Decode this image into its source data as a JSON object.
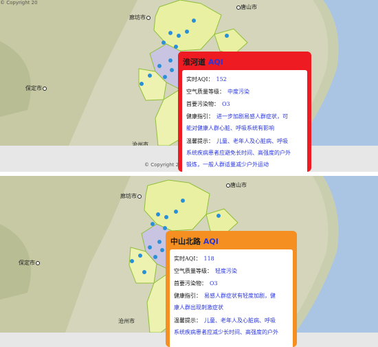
{
  "panels": [
    {
      "cities": {
        "langfang": "廊坊市",
        "tangshan": "唐山市",
        "baoding": "保定市",
        "cangzhou": "沧州市"
      },
      "copyright": "© Copyright 20",
      "popup": {
        "station": "淮河道",
        "aqi_label": "AQI",
        "color": "#ee1c22",
        "realtime_label": "实时AQI：",
        "realtime_value": "152",
        "quality_label": "空气质量等级：",
        "quality_value": "中度污染",
        "pollutant_label": "首要污染物：",
        "pollutant_value": "O3",
        "health_label": "健康指引：",
        "health_line1": "进一步加剧易感人群症状，可",
        "health_line2": "能对健康人群心脏、呼吸系统有影响",
        "tips_label": "温馨提示：",
        "tips_line1": "儿童、老年人及心脏病、呼吸",
        "tips_line2": "系统疾病患者应避免长时间、高强度的户外",
        "tips_line3": "锻炼，一般人群适量减少户外运动"
      }
    },
    {
      "cities": {
        "langfang": "廊坊市",
        "tangshan": "唐山市",
        "baoding": "保定市",
        "cangzhou": "沧州市"
      },
      "copyright": "© Copyright 20",
      "popup": {
        "station": "中山北路",
        "aqi_label": "AQI",
        "color": "#f58f21",
        "realtime_label": "实时AQI：",
        "realtime_value": "118",
        "quality_label": "空气质量等级：",
        "quality_value": "轻度污染",
        "pollutant_label": "首要污染物：",
        "pollutant_value": "O3",
        "health_label": "健康指引：",
        "health_line1": "易感人群症状有轻度加剧，健",
        "health_line2": "康人群出现刺激症状",
        "tips_label": "温馨提示：",
        "tips_line1": "儿童、老年人及心脏病、呼吸",
        "tips_line2": "系统疾病患者应减少长时间、高强度的户外"
      }
    }
  ]
}
